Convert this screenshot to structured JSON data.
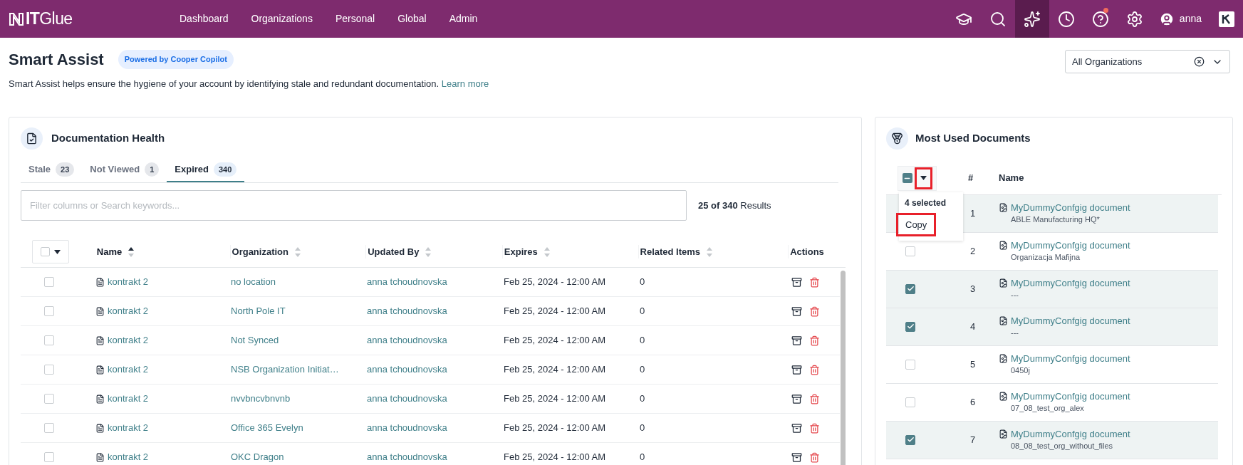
{
  "nav": {
    "logo": "**IT**Glue",
    "links": [
      "Dashboard",
      "Organizations",
      "Personal",
      "Global",
      "Admin"
    ],
    "icons": [
      {
        "kind": "learn",
        "selected": false,
        "badge": false
      },
      {
        "kind": "search",
        "selected": false,
        "badge": false
      },
      {
        "kind": "assist",
        "selected": true,
        "badge": false
      },
      {
        "kind": "history",
        "selected": false,
        "badge": false
      },
      {
        "kind": "help",
        "selected": false,
        "badge": true
      },
      {
        "kind": "settings",
        "selected": false,
        "badge": false
      }
    ],
    "user": "anna"
  },
  "header": {
    "title": "Smart Assist",
    "badge": "Powered by Cooper Copilot",
    "description": "Smart Assist helps ensure the hygiene of your account by identifying stale and redundant documentation.",
    "link": "Learn more",
    "org_select": {
      "value": "All Organizations"
    }
  },
  "doc_health": {
    "title": "Documentation Health",
    "tabs": [
      {
        "label": "Stale",
        "count": "23",
        "selected": false
      },
      {
        "label": "Not Viewed",
        "count": "1",
        "selected": false
      },
      {
        "label": "Expired",
        "count": "340",
        "selected": true
      }
    ],
    "search": {
      "placeholder": "Filter columns or Search keywords..."
    },
    "results": "**25 of 340** Results",
    "columns": [
      {
        "label": "Name",
        "sortable": true,
        "sorted": true
      },
      {
        "label": "Organization",
        "sortable": true,
        "sorted": false
      },
      {
        "label": "Updated By",
        "sortable": true,
        "sorted": false
      },
      {
        "label": "Expires",
        "sortable": true,
        "sorted": false
      },
      {
        "label": "Related Items",
        "sortable": true,
        "sorted": false
      },
      {
        "label": "Actions",
        "sortable": false,
        "sorted": false
      }
    ],
    "rows": [
      {
        "checked": false,
        "name": "kontrakt 2",
        "organization": "no location",
        "updated_by": "anna tchoudnovska",
        "expires": "Feb 25, 2024 - 12:00 AM",
        "related": "0"
      },
      {
        "checked": false,
        "name": "kontrakt 2",
        "organization": "North Pole IT",
        "updated_by": "anna tchoudnovska",
        "expires": "Feb 25, 2024 - 12:00 AM",
        "related": "0"
      },
      {
        "checked": false,
        "name": "kontrakt 2",
        "organization": "Not Synced",
        "updated_by": "anna tchoudnovska",
        "expires": "Feb 25, 2024 - 12:00 AM",
        "related": "0"
      },
      {
        "checked": false,
        "name": "kontrakt 2",
        "organization": "NSB Organization Initiat…",
        "updated_by": "anna tchoudnovska",
        "expires": "Feb 25, 2024 - 12:00 AM",
        "related": "0"
      },
      {
        "checked": false,
        "name": "kontrakt 2",
        "organization": "nvvbncvbnvnb",
        "updated_by": "anna tchoudnovska",
        "expires": "Feb 25, 2024 - 12:00 AM",
        "related": "0"
      },
      {
        "checked": false,
        "name": "kontrakt 2",
        "organization": "Office 365 Evelyn",
        "updated_by": "anna tchoudnovska",
        "expires": "Feb 25, 2024 - 12:00 AM",
        "related": "0"
      },
      {
        "checked": false,
        "name": "kontrakt 2",
        "organization": "OKC Dragon",
        "updated_by": "anna tchoudnovska",
        "expires": "Feb 25, 2024 - 12:00 AM",
        "related": "0"
      }
    ]
  },
  "most_used": {
    "title": "Most Used Documents",
    "columns": [
      "#",
      "Name"
    ],
    "bulk": {
      "partial": true,
      "caret_highlighted": true
    },
    "menu": {
      "open": true,
      "count": "4 selected",
      "items": [
        {
          "label": "Copy",
          "highlighted": true
        }
      ]
    },
    "rows": [
      {
        "checked": true,
        "number": "1",
        "name": "MyDummyConfgig document",
        "organization": "ABLE Manufacturing HQ*"
      },
      {
        "checked": false,
        "number": "2",
        "name": "MyDummyConfgig document",
        "organization": "Organizacja Mafijna"
      },
      {
        "checked": true,
        "number": "3",
        "name": "MyDummyConfgig document",
        "organization": "---"
      },
      {
        "checked": true,
        "number": "4",
        "name": "MyDummyConfgig document",
        "organization": "---"
      },
      {
        "checked": false,
        "number": "5",
        "name": "MyDummyConfgig document",
        "organization": "0450j"
      },
      {
        "checked": false,
        "number": "6",
        "name": "MyDummyConfgig document",
        "organization": "07_08_test_org_alex"
      },
      {
        "checked": true,
        "number": "7",
        "name": "MyDummyConfgig document",
        "organization": "08_08_test_org_without_files"
      }
    ]
  }
}
